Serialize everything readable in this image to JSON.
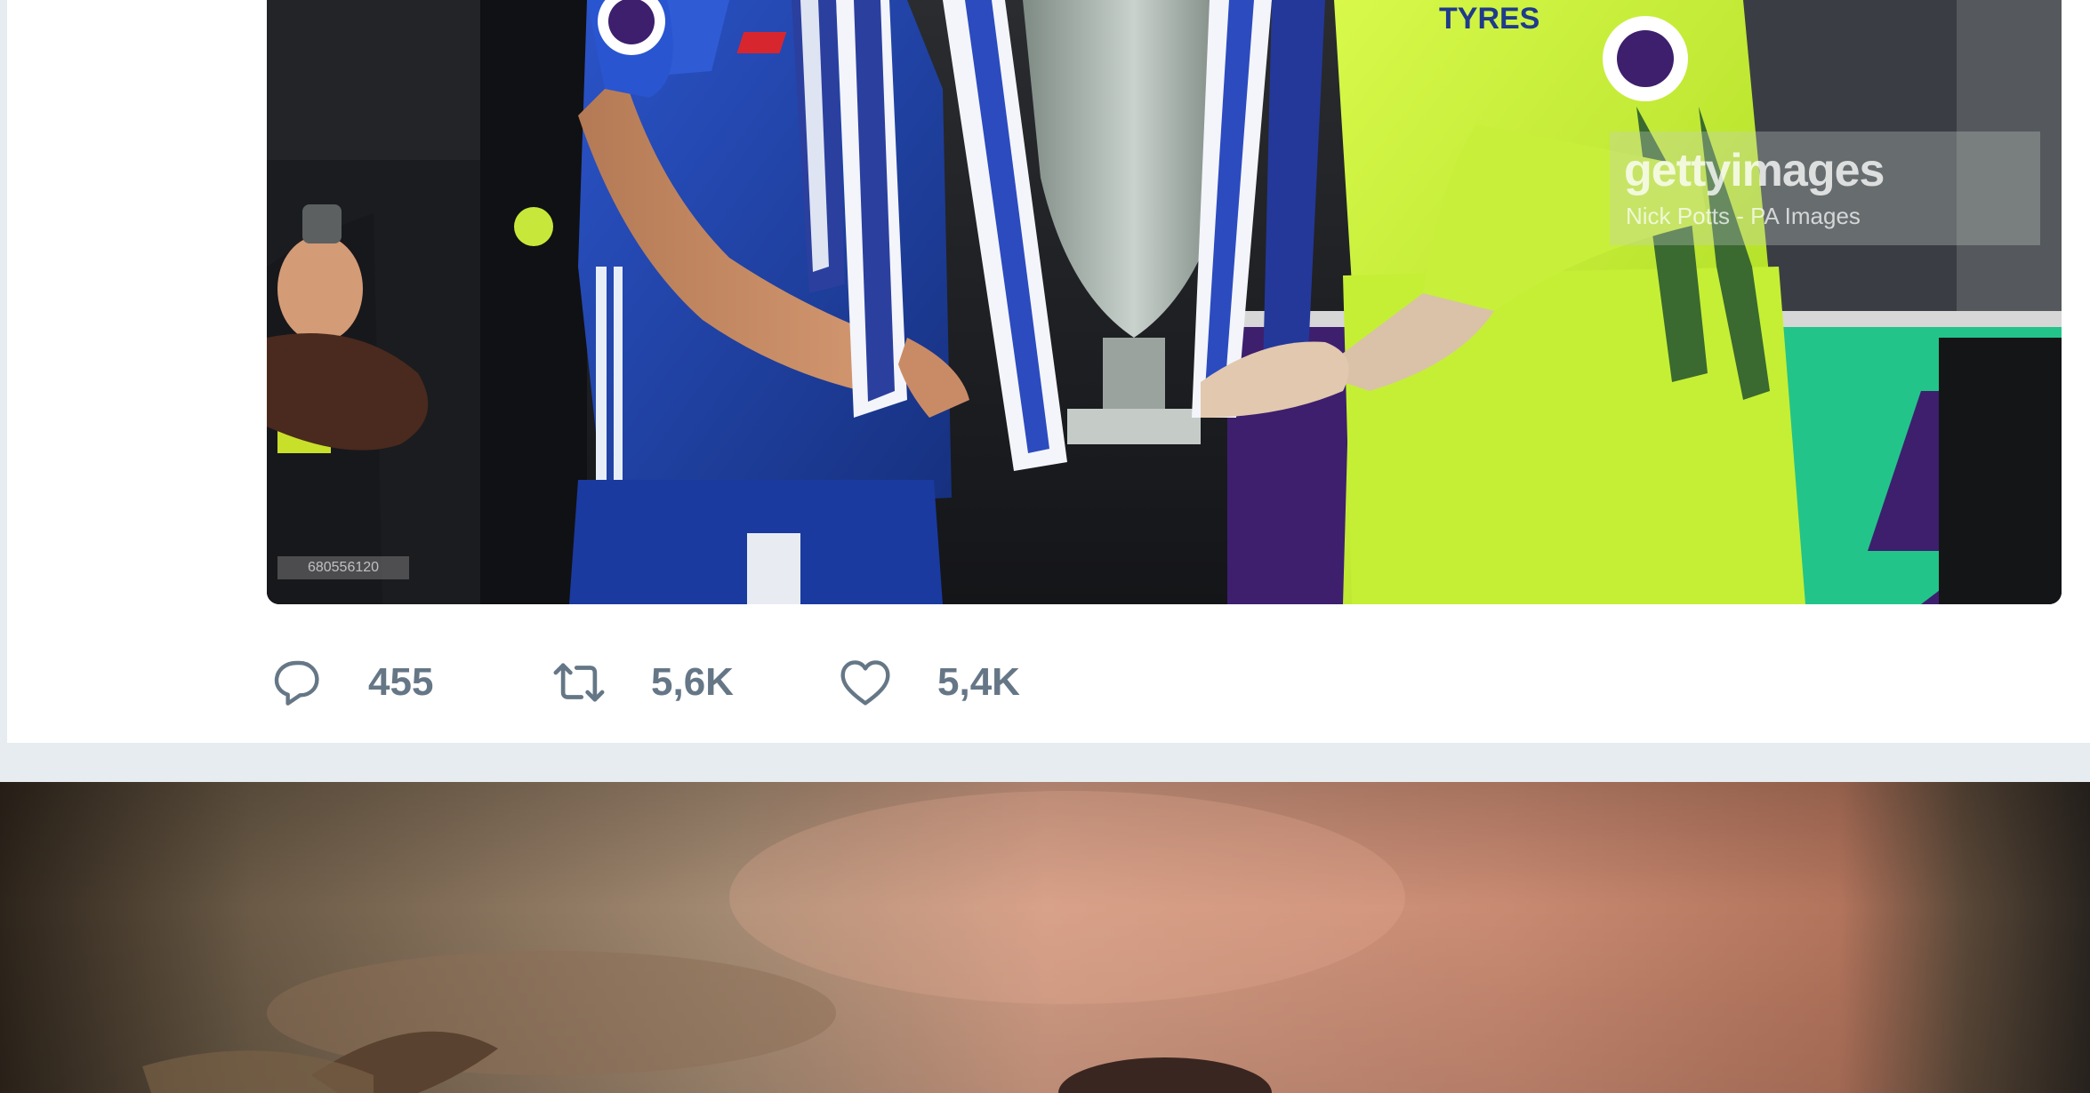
{
  "tweet": {
    "media": {
      "alt": "",
      "watermark_brand": "gettyimages",
      "watermark_credit": "Nick Potts - PA Images",
      "image_id": "680556120",
      "sponsor_text": "TYRES"
    },
    "actions": {
      "reply": {
        "count": "455",
        "icon": "reply-icon"
      },
      "retweet": {
        "count": "5,6K",
        "icon": "retweet-icon"
      },
      "like": {
        "count": "5,4K",
        "icon": "heart-icon"
      }
    }
  },
  "colors": {
    "action_gray": "#657786",
    "divider": "#e6ecf0",
    "chelsea_blue": "#1d3fa8",
    "keeper_yellow": "#c8f23a",
    "pl_purple": "#3d1f6e",
    "pl_green": "#23c48a"
  }
}
